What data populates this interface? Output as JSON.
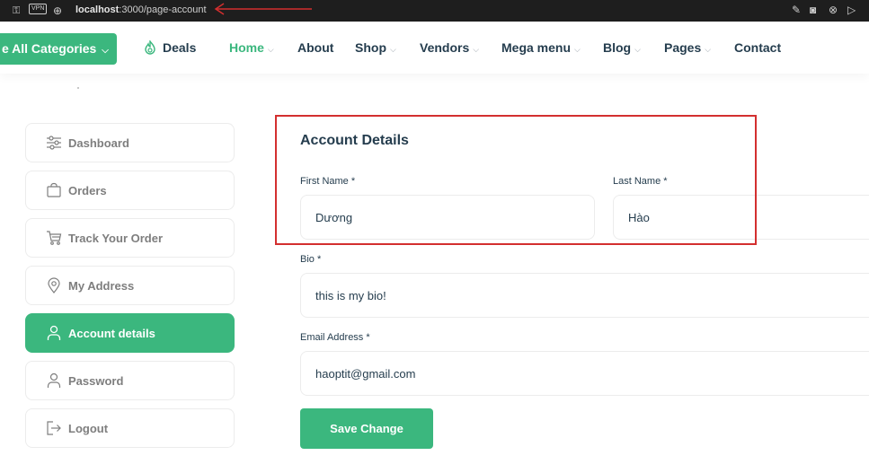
{
  "browser": {
    "url_host": "localhost",
    "url_path": ":3000/page-account",
    "vpn_label": "VPN"
  },
  "nav": {
    "categories_label": "e All Categories",
    "deals_label": "Deals",
    "items": [
      {
        "label": "Home",
        "has_dropdown": true,
        "active": true
      },
      {
        "label": "About",
        "has_dropdown": false
      },
      {
        "label": "Shop",
        "has_dropdown": true
      },
      {
        "label": "Vendors",
        "has_dropdown": true
      },
      {
        "label": "Mega menu",
        "has_dropdown": true
      },
      {
        "label": "Blog",
        "has_dropdown": true
      },
      {
        "label": "Pages",
        "has_dropdown": true
      },
      {
        "label": "Contact",
        "has_dropdown": false
      }
    ]
  },
  "sidebar": {
    "items": [
      {
        "label": "Dashboard",
        "icon": "sliders-icon"
      },
      {
        "label": "Orders",
        "icon": "shopping-bag-icon"
      },
      {
        "label": "Track Your Order",
        "icon": "cart-icon"
      },
      {
        "label": "My Address",
        "icon": "location-pin-icon"
      },
      {
        "label": "Account details",
        "icon": "user-icon",
        "active": true
      },
      {
        "label": "Password",
        "icon": "user-icon"
      },
      {
        "label": "Logout",
        "icon": "sign-out-icon"
      }
    ]
  },
  "account": {
    "title": "Account Details",
    "first_name_label": "First Name *",
    "first_name_value": "Dương",
    "last_name_label": "Last Name *",
    "last_name_value": "Hào",
    "bio_label": "Bio *",
    "bio_value": "this is my bio!",
    "email_label": "Email Address *",
    "email_value": "haoptit@gmail.com",
    "save_label": "Save Change"
  },
  "colors": {
    "accent": "#3bb77e",
    "text_dark": "#253d4e",
    "annotation_red": "#d32f2f"
  }
}
